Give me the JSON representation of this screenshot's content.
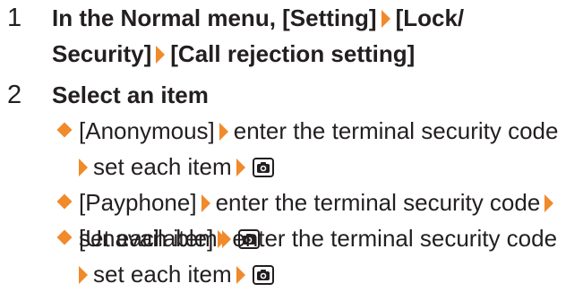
{
  "accent_color": "#f08a2a",
  "steps": [
    {
      "num": "1",
      "line1_a": "In the Normal menu, [Setting]",
      "line1_b": "[Lock/",
      "line2_a": "Security]",
      "line2_b": "[Call rejection setting]"
    },
    {
      "num": "2",
      "text": "Select an item"
    }
  ],
  "items": [
    {
      "label": "[Anonymous]",
      "action1": "enter the terminal security code",
      "action2": "set each item",
      "key_icon": "camera-key-icon"
    },
    {
      "label": "[Payphone]",
      "action1": "enter the terminal security code",
      "action2": "set each item",
      "key_icon": "camera-key-icon"
    },
    {
      "label": "[Unavailable]",
      "action1": "enter the terminal security code",
      "action2": "set each item",
      "key_icon": "camera-key-icon"
    }
  ]
}
